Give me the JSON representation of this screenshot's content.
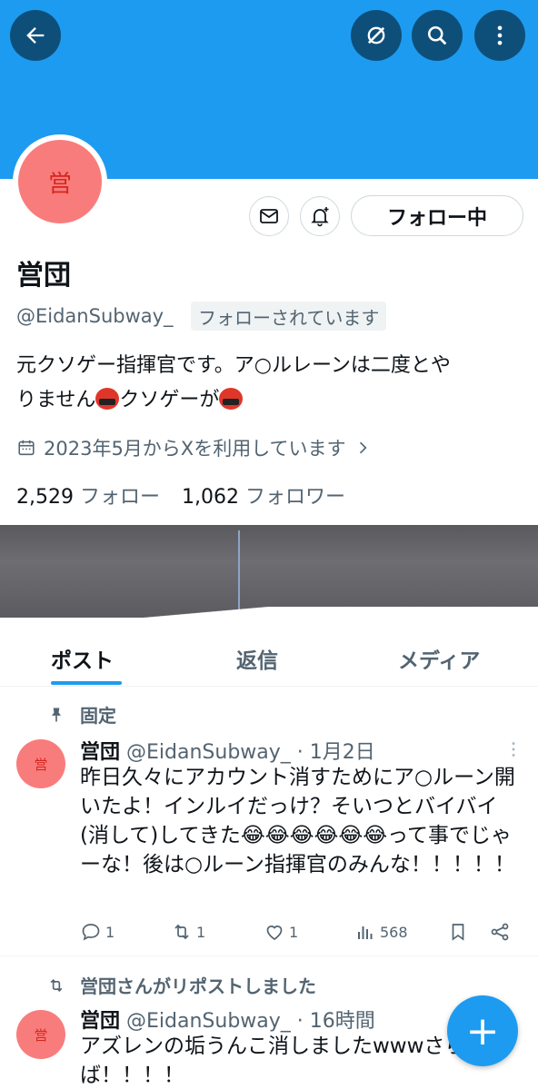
{
  "header": {
    "back_icon": "arrow-left-icon",
    "icons": [
      "grok-icon",
      "search-icon",
      "more-vertical-icon"
    ],
    "banner_color": "#1d9bf0"
  },
  "profile": {
    "avatar_text": "営",
    "name": "営団",
    "handle": "@EidanSubway_",
    "follows_you": "フォローされています",
    "follow_button": "フォロー中",
    "bio_line1": "元クソゲー指揮官です。ア○ルレーンは二度とや",
    "bio_line2a": "りません",
    "bio_line2b": "クソゲーが",
    "joined": "2023年5月からXを利用しています",
    "following_count": "2,529",
    "following_label": "フォロー",
    "followers_count": "1,062",
    "followers_label": "フォロワー"
  },
  "tabs": [
    {
      "label": "ポスト",
      "active": true
    },
    {
      "label": "返信",
      "active": false
    },
    {
      "label": "メディア",
      "active": false
    }
  ],
  "pinned_label": "固定",
  "tweet1": {
    "avatar_text": "営",
    "name": "営団",
    "handle": "@EidanSubway_",
    "time": "· 1月2日",
    "text_a": "昨日久々にアカウント消すためにア○ルーン開いたよ！インルイだっけ？そいつとバイバイ(消して)してきた",
    "text_b": "って事でじゃーな！後は○ルーン指揮官のみんな！！！！！",
    "emoji": "😂😂😂😂😂😂",
    "replies": "1",
    "reposts": "1",
    "likes": "1",
    "views": "568"
  },
  "repost_label": "営団さんがリポストしました",
  "tweet2": {
    "avatar_text": "営",
    "name": "営団",
    "handle": "@EidanSubway_",
    "time": "· 16時間",
    "text": "アズレンの垢うんこ消しましたwwwさらば！！！！"
  },
  "fab": "+"
}
